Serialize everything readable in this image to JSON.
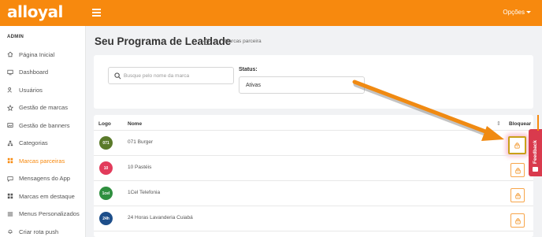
{
  "header": {
    "logo_text": "alloyal",
    "options_label": "Opções"
  },
  "sidebar": {
    "section_title": "ADMIN",
    "items": [
      {
        "label": "Página Inicial",
        "icon": "home-icon"
      },
      {
        "label": "Dashboard",
        "icon": "monitor-icon"
      },
      {
        "label": "Usuários",
        "icon": "users-icon"
      },
      {
        "label": "Gestão de marcas",
        "icon": "star-icon"
      },
      {
        "label": "Gestão de banners",
        "icon": "image-icon"
      },
      {
        "label": "Categorias",
        "icon": "sitemap-icon"
      },
      {
        "label": "Marcas parceiras",
        "icon": "grid-icon"
      },
      {
        "label": "Mensagens do App",
        "icon": "chat-icon"
      },
      {
        "label": "Marcas em destaque",
        "icon": "layout-icon"
      },
      {
        "label": "Menus Personalizados",
        "icon": "list-icon"
      },
      {
        "label": "Criar rota push",
        "icon": "bell-icon"
      }
    ],
    "active_index": 6
  },
  "page": {
    "title": "Seu Programa de Lealdade",
    "breadcrumb": "Marcas parceira"
  },
  "filters": {
    "search_placeholder": "Busque pelo nome da marca",
    "status_label": "Status:",
    "status_value": "Ativas"
  },
  "table": {
    "headers": {
      "logo": "Logo",
      "name": "Nome",
      "block": "Bloquear"
    },
    "rows": [
      {
        "name": "071 Burger",
        "logo_text": "071",
        "logo_color": "#5a7a2a"
      },
      {
        "name": "10 Pastéis",
        "logo_text": "10",
        "logo_color": "#e23b5b"
      },
      {
        "name": "1Cel Telefonia",
        "logo_text": "1cel",
        "logo_color": "#2f8f3f"
      },
      {
        "name": "24 Horas Lavanderia Cuiabá",
        "logo_text": "24h",
        "logo_color": "#1d4e8a"
      }
    ]
  },
  "feedback_label": "Feedback",
  "colors": {
    "brand_orange": "#f7890e",
    "arrow_orange": "#f08a12",
    "feedback_red": "#d93a4d"
  }
}
